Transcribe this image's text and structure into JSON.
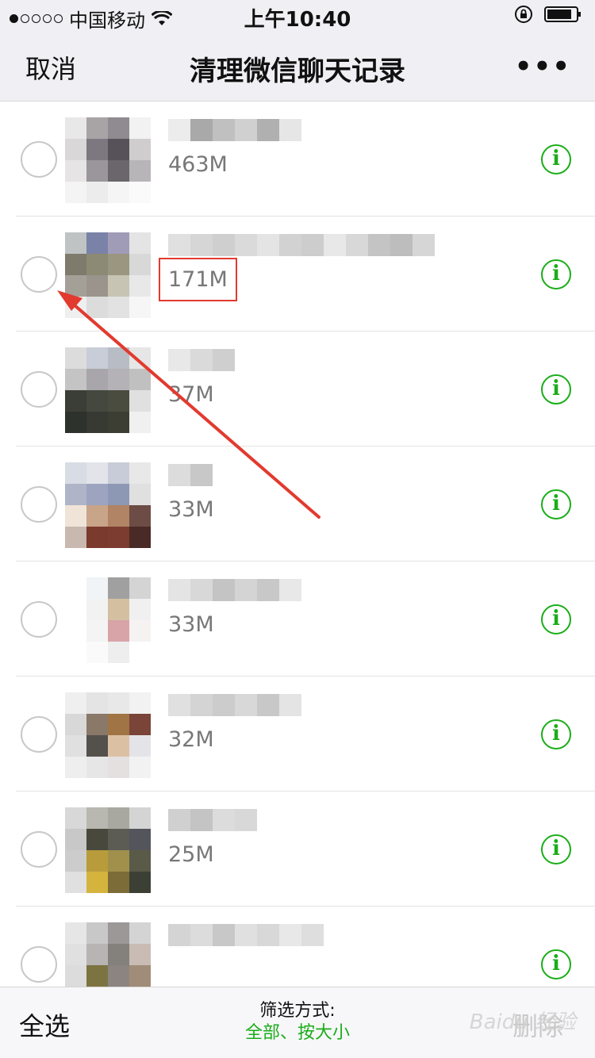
{
  "status": {
    "carrier": "中国移动",
    "time": "上午10:40"
  },
  "navbar": {
    "cancel": "取消",
    "title": "清理微信聊天记录",
    "more": "•••"
  },
  "chats": [
    {
      "size": "463M",
      "highlighted": false
    },
    {
      "size": "171M",
      "highlighted": true
    },
    {
      "size": "37M",
      "highlighted": false
    },
    {
      "size": "33M",
      "highlighted": false
    },
    {
      "size": "33M",
      "highlighted": false
    },
    {
      "size": "32M",
      "highlighted": false
    },
    {
      "size": "25M",
      "highlighted": false
    },
    {
      "size": "",
      "highlighted": false
    }
  ],
  "info_icon": "i",
  "bottom": {
    "select_all": "全选",
    "filter_label": "筛选方式:",
    "filter_value": "全部、按大小",
    "delete": "删除"
  },
  "watermark": "Baidu 经验",
  "colors": {
    "accent_green": "#1aad19",
    "annotation_red": "#e23a2f",
    "bar_bg": "#efeff4"
  },
  "icons": [
    "wifi-icon",
    "lock-rotation-icon",
    "battery-icon",
    "more-icon",
    "info-icon",
    "radio-icon"
  ]
}
